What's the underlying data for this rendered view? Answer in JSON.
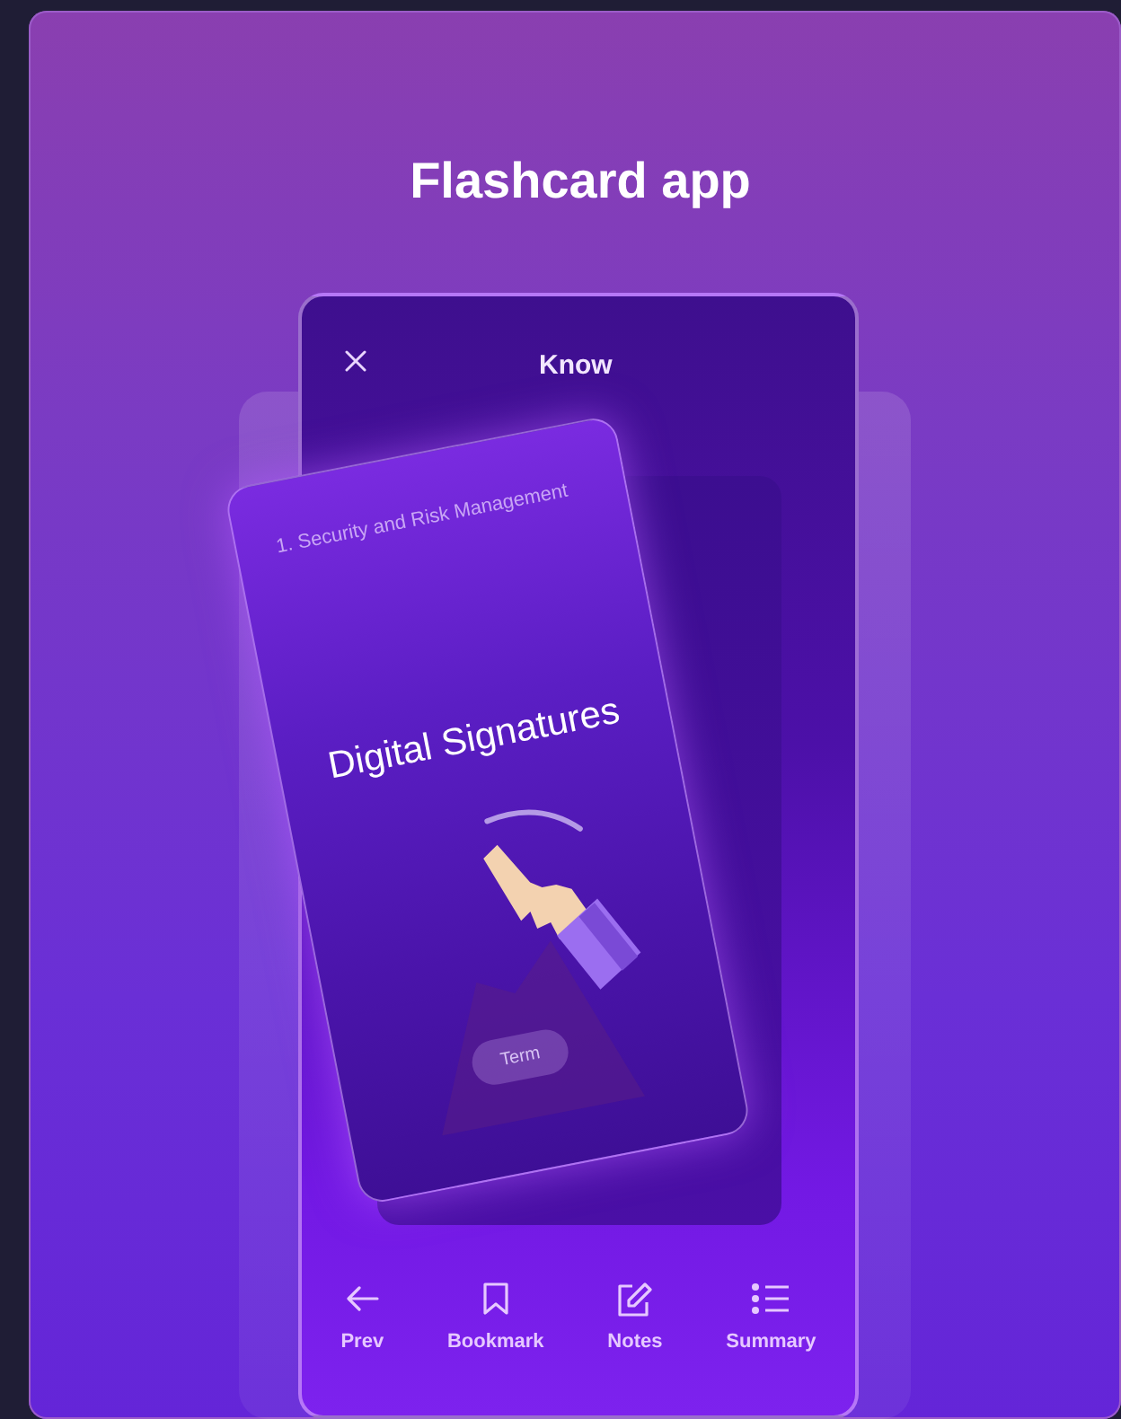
{
  "app_title": "Flashcard app",
  "screen": {
    "title": "Know"
  },
  "card": {
    "category": "1. Security and Risk Management",
    "term": "Digital Signatures",
    "flip_button": "Term"
  },
  "nav": [
    {
      "label": "Prev",
      "kind": "back"
    },
    {
      "label": "Bookmark",
      "kind": "bookmark"
    },
    {
      "label": "Notes",
      "kind": "notes"
    },
    {
      "label": "Summary",
      "kind": "summary"
    }
  ]
}
